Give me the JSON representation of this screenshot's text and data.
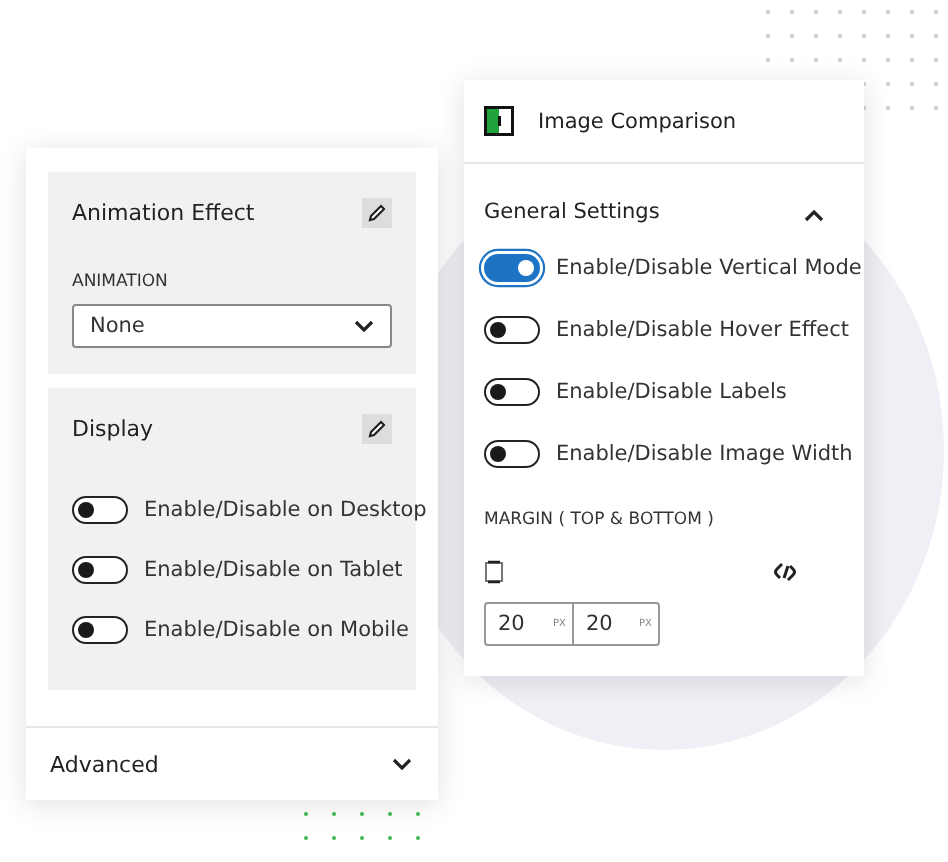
{
  "left_panel": {
    "animation_section": {
      "title": "Animation Effect",
      "field_label": "ANIMATION",
      "select_value": "None"
    },
    "display_section": {
      "title": "Display",
      "toggles": [
        {
          "label": "Enable/Disable on Desktop",
          "on": false
        },
        {
          "label": "Enable/Disable on Tablet",
          "on": false
        },
        {
          "label": "Enable/Disable on Mobile",
          "on": false
        }
      ]
    },
    "advanced_section": {
      "title": "Advanced",
      "expanded": false
    }
  },
  "right_panel": {
    "title": "Image Comparison",
    "general_section": {
      "title": "General Settings",
      "expanded": true,
      "toggles": [
        {
          "label": "Enable/Disable Vertical Mode",
          "on": true
        },
        {
          "label": "Enable/Disable Hover Effect",
          "on": false
        },
        {
          "label": "Enable/Disable Labels",
          "on": false
        },
        {
          "label": "Enable/Disable Image Width",
          "on": false
        }
      ]
    },
    "margin_label": "MARGIN ( TOP & BOTTOM )",
    "margin_inputs": [
      {
        "value": "20",
        "unit": "PX"
      },
      {
        "value": "20",
        "unit": "PX"
      }
    ]
  }
}
